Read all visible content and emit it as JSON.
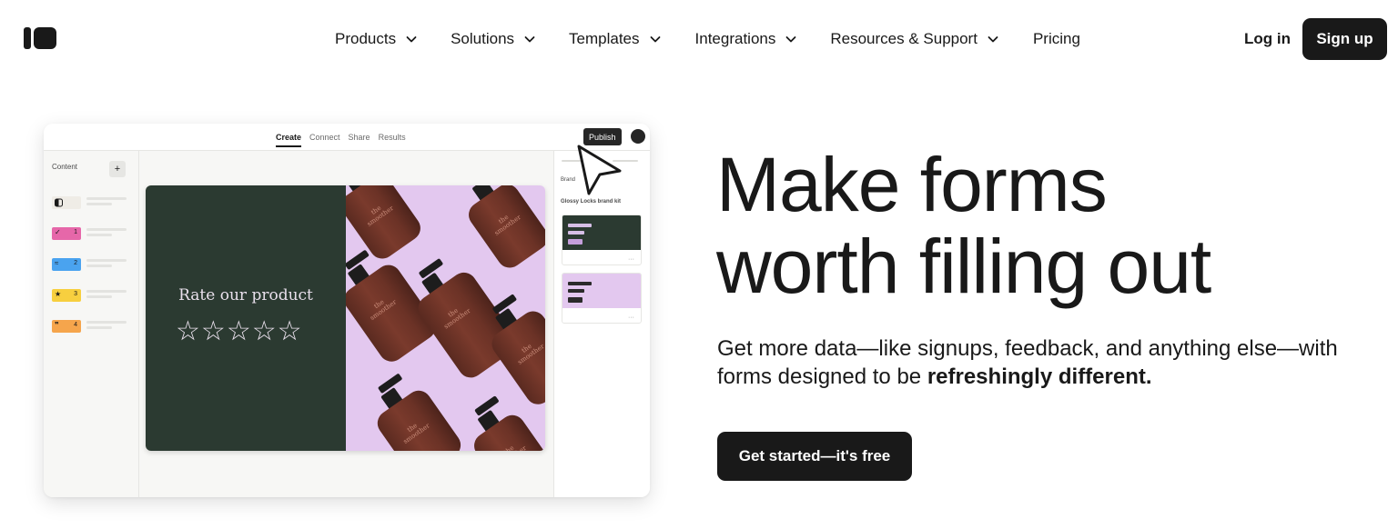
{
  "nav": {
    "items": [
      {
        "label": "Products"
      },
      {
        "label": "Solutions"
      },
      {
        "label": "Templates"
      },
      {
        "label": "Integrations"
      },
      {
        "label": "Resources & Support"
      },
      {
        "label": "Pricing"
      }
    ],
    "login_label": "Log in",
    "signup_label": "Sign up"
  },
  "mockup": {
    "tabs": [
      "Create",
      "Connect",
      "Share",
      "Results"
    ],
    "publish_label": "Publish",
    "content_label": "Content",
    "add_label": "+",
    "questions": [
      {
        "num": "",
        "icon": "opinion-scale-icon",
        "color": "#efece6"
      },
      {
        "num": "1",
        "icon": "checkmark-icon",
        "color": "#e667a9"
      },
      {
        "num": "2",
        "icon": "link-icon",
        "color": "#4aa3ef"
      },
      {
        "num": "3",
        "icon": "star-icon",
        "color": "#f7cf3f"
      },
      {
        "num": "4",
        "icon": "quote-icon",
        "color": "#f5a54c"
      }
    ],
    "canvas": {
      "prompt": "Rate our product",
      "rating_max": 5,
      "bottle_label": "the smoother"
    },
    "sidebar": {
      "brand_label": "Brand",
      "kit_label": "Glossy Locks brand kit",
      "card_menu": "···"
    }
  },
  "hero": {
    "headline_line1": "Make forms",
    "headline_line2": "worth filling out",
    "sub_text": "Get more data—like signups, feedback, and anything else—with forms designed to be ",
    "sub_bold": "refreshingly different.",
    "cta_label": "Get started—it's free"
  },
  "colors": {
    "ink": "#191919",
    "canvas_green": "#2b3a31",
    "canvas_lilac": "#e3c8ef",
    "bottle_brown": "#6b3226"
  }
}
